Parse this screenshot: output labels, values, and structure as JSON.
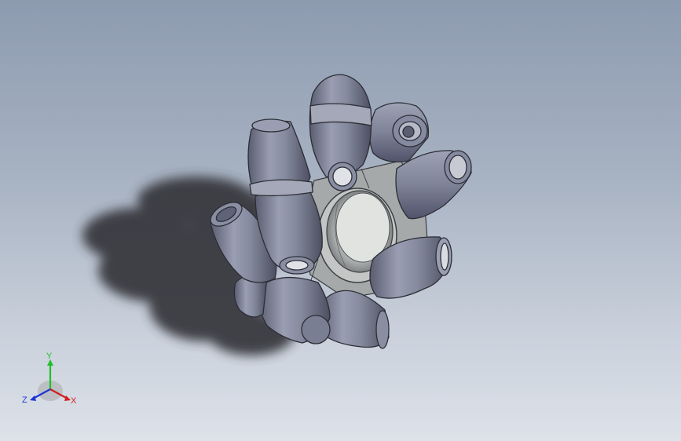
{
  "viewport": {
    "background_top": "#8d9bb0",
    "background_bottom": "#dde2e9"
  },
  "model": {
    "icon": "mecanum-wheel-model",
    "roller_color": "#7a7e93",
    "hub_color": "#b9bcbe",
    "shadow_color": "#3a3c40"
  },
  "triad": {
    "x_label": "X",
    "y_label": "Y",
    "z_label": "Z",
    "x_color": "#d21f1f",
    "y_color": "#1fbf2a",
    "z_color": "#2036d4"
  }
}
